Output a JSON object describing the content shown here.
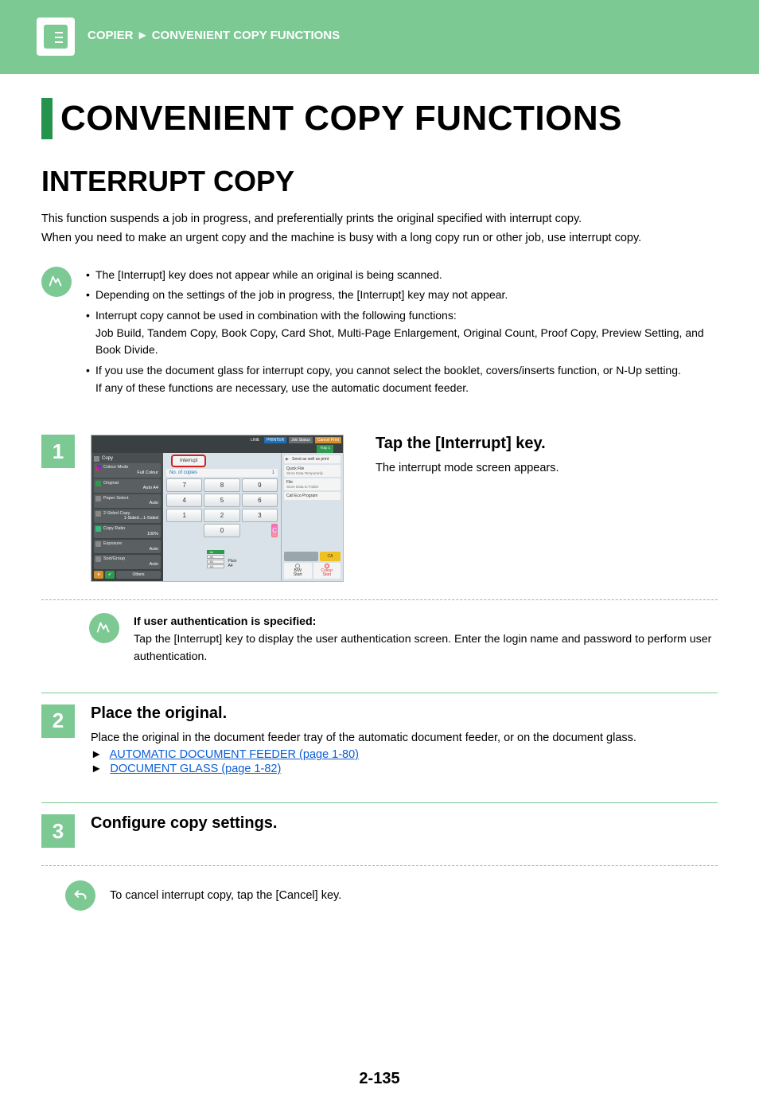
{
  "header": {
    "breadcrumb_a": "COPIER",
    "breadcrumb_sep": "►",
    "breadcrumb_b": "CONVENIENT COPY FUNCTIONS"
  },
  "titles": {
    "main": "CONVENIENT COPY FUNCTIONS",
    "section": "INTERRUPT COPY"
  },
  "intro": {
    "p1": "This function suspends a job in progress, and preferentially prints the original specified with interrupt copy.",
    "p2": "When you need to make an urgent copy and the machine is busy with a long copy run or other job, use interrupt copy."
  },
  "notes": {
    "n1": "The [Interrupt] key does not appear while an original is being scanned.",
    "n2": "Depending on the settings of the job in progress, the [Interrupt] key may not appear.",
    "n3a": "Interrupt copy cannot be used in combination with the following functions:",
    "n3b": "Job Build, Tandem Copy, Book Copy, Card Shot, Multi-Page Enlargement, Original Count, Proof Copy, Preview Setting, and Book Divide.",
    "n4a": "If you use the document glass for interrupt copy, you cannot select the booklet, covers/inserts function, or N-Up setting.",
    "n4b": "If any of these functions are necessary, use the automatic document feeder."
  },
  "steps": {
    "s1": {
      "num": "1",
      "heading": "Tap the [Interrupt] key.",
      "text": "The interrupt mode screen appears."
    },
    "s2": {
      "num": "2",
      "heading": "Place the original.",
      "text": "Place the original in the document feeder tray of the automatic document feeder, or on the document glass.",
      "link1": "AUTOMATIC DOCUMENT FEEDER (page 1-80)",
      "link2": "DOCUMENT GLASS (page 1-82)"
    },
    "s3": {
      "num": "3",
      "heading": "Configure copy settings."
    }
  },
  "auth": {
    "title": "If user authentication is specified:",
    "text": "Tap the [Interrupt] key to display the user authentication screen. Enter the login name and password to perform user authentication."
  },
  "cancel": {
    "text": "To cancel interrupt copy, tap the [Cancel] key."
  },
  "footer": {
    "page": "2-135"
  },
  "panel": {
    "topbar": {
      "line": "LINE",
      "printer": "PRINTER",
      "status": "Job Status",
      "cancel": "Cancel Print",
      "tray": "Tray 1"
    },
    "copy_label": "Copy",
    "interrupt": "Interrupt",
    "copies_label": "No. of copies",
    "copies_value": "1",
    "keys": {
      "k7": "7",
      "k8": "8",
      "k9": "9",
      "k4": "4",
      "k5": "5",
      "k6": "6",
      "k1": "1",
      "k2": "2",
      "k3": "3",
      "k0": "0",
      "c": "C"
    },
    "left": {
      "colour_mode": {
        "t": "Colour Mode",
        "v": "Full Colour"
      },
      "original": {
        "t": "Original",
        "v": "Auto  A4"
      },
      "paper": {
        "t": "Paper Select",
        "v": "Auto"
      },
      "twosided": {
        "t": "2-Sided Copy",
        "v": "1-Sided→1-Sided"
      },
      "ratio": {
        "t": "Copy Ratio",
        "v": "100%"
      },
      "exposure": {
        "t": "Exposure",
        "v": "Auto"
      },
      "sort": {
        "t": "Sort/Group",
        "v": "Auto"
      },
      "others": "Others"
    },
    "right": {
      "send": "Send as well as print",
      "quick": "Quick File",
      "quick_sub": "Store Data Temporarily",
      "file": "File",
      "file_sub": "Store Data to Folder",
      "eco": "Call Eco Program",
      "ca": "CA",
      "bw": "B/W",
      "start": "Start",
      "colour": "Colour"
    },
    "trays": {
      "plain": "Plain",
      "a4s": "A4",
      "a4": "A4",
      "b4": "B4",
      "a3": "A3"
    }
  }
}
